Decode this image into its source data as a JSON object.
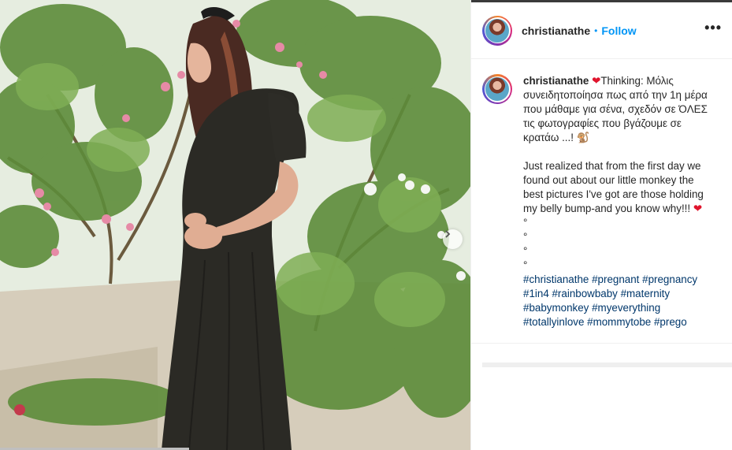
{
  "post": {
    "username": "christianathe",
    "follow_label": "Follow",
    "separator": "•",
    "more_label": "•••",
    "caption": {
      "username": "christianathe",
      "heart": "❤",
      "greek_text": "Thinking: Μόλις συνειδητοποίησα πως από την 1η μέρα που μάθαμε για σένα, σχεδόν σε ΌΛΕΣ τις φωτογραφίες που βγάζουμε σε κρατάω ...! 🐒",
      "english_text": "Just realized that from the first day we found out about our little monkey the best pictures I've got are those holding my belly bump-and you know why!!!",
      "english_heart": "❤",
      "dots": [
        "°",
        "°",
        "°",
        "°"
      ],
      "hashtags": "#christianathe #pregnant #pregnancy #1in4 #rainbowbaby #maternity #babymonkey #myeverything #totallyinlove #mommytobe #prego"
    }
  },
  "icons": {
    "next": "chevron-right-icon",
    "more": "more-options-icon"
  },
  "colors": {
    "link": "#0095f6",
    "hashtag": "#00376b",
    "heart": "#e0152d"
  }
}
